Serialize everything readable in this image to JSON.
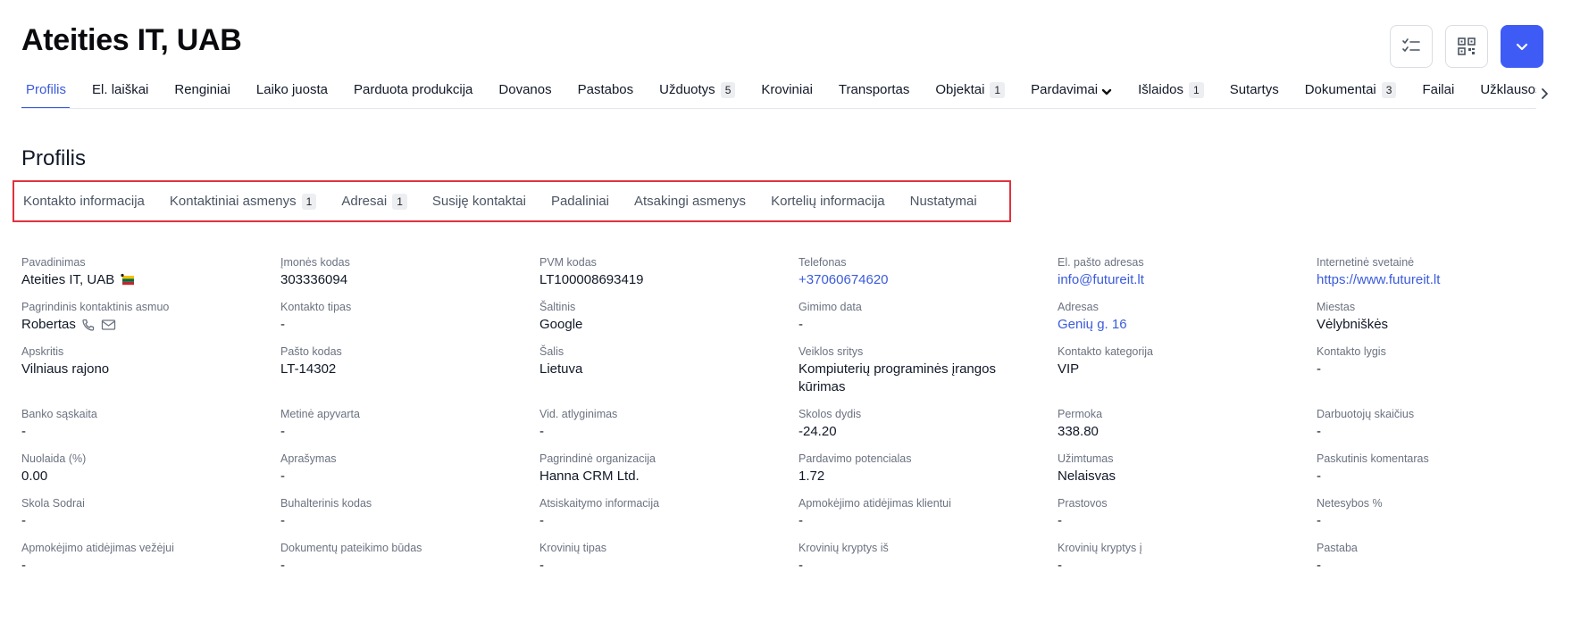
{
  "header": {
    "title": "Ateities IT, UAB"
  },
  "main_tabs": [
    {
      "label": "Profilis",
      "active": true
    },
    {
      "label": "El. laiškai"
    },
    {
      "label": "Renginiai"
    },
    {
      "label": "Laiko juosta"
    },
    {
      "label": "Parduota produkcija"
    },
    {
      "label": "Dovanos"
    },
    {
      "label": "Pastabos"
    },
    {
      "label": "Užduotys",
      "badge": "5"
    },
    {
      "label": "Kroviniai"
    },
    {
      "label": "Transportas"
    },
    {
      "label": "Objektai",
      "badge": "1"
    },
    {
      "label": "Pardavimai",
      "dropdown": true
    },
    {
      "label": "Išlaidos",
      "badge": "1"
    },
    {
      "label": "Sutartys"
    },
    {
      "label": "Dokumentai",
      "badge": "3"
    },
    {
      "label": "Failai"
    },
    {
      "label": "Užklausos"
    }
  ],
  "section": {
    "title": "Profilis"
  },
  "sub_tabs": [
    {
      "label": "Kontakto informacija"
    },
    {
      "label": "Kontaktiniai asmenys",
      "badge": "1"
    },
    {
      "label": "Adresai",
      "badge": "1"
    },
    {
      "label": "Susiję kontaktai"
    },
    {
      "label": "Padaliniai"
    },
    {
      "label": "Atsakingi asmenys"
    },
    {
      "label": "Kortelių informacija"
    },
    {
      "label": "Nustatymai"
    }
  ],
  "fields": {
    "row1": {
      "name_label": "Pavadinimas",
      "name_value": "Ateities IT, UAB",
      "company_code_label": "Įmonės kodas",
      "company_code_value": "303336094",
      "vat_label": "PVM kodas",
      "vat_value": "LT100008693419",
      "phone_label": "Telefonas",
      "phone_value": "+37060674620",
      "email_label": "El. pašto adresas",
      "email_value": "info@futureit.lt",
      "website_label": "Internetinė svetainė",
      "website_value": "https://www.futureit.lt"
    },
    "row2": {
      "main_contact_label": "Pagrindinis kontaktinis asmuo",
      "main_contact_value": "Robertas",
      "contact_type_label": "Kontakto tipas",
      "contact_type_value": "-",
      "source_label": "Šaltinis",
      "source_value": "Google",
      "birth_label": "Gimimo data",
      "birth_value": "-",
      "address_label": "Adresas",
      "address_value": "Genių g. 16",
      "city_label": "Miestas",
      "city_value": "Vėlybniškės"
    },
    "row3": {
      "county_label": "Apskritis",
      "county_value": "Vilniaus rajono",
      "postal_label": "Pašto kodas",
      "postal_value": "LT-14302",
      "country_label": "Šalis",
      "country_value": "Lietuva",
      "activity_label": "Veiklos sritys",
      "activity_value": "Kompiuterių programinės įrangos kūrimas",
      "category_label": "Kontakto kategorija",
      "category_value": "VIP",
      "level_label": "Kontakto lygis",
      "level_value": "-"
    },
    "row4": {
      "bank_label": "Banko sąskaita",
      "bank_value": "-",
      "turnover_label": "Metinė apyvarta",
      "turnover_value": "-",
      "salary_label": "Vid. atlyginimas",
      "salary_value": "-",
      "debt_label": "Skolos dydis",
      "debt_value": "-24.20",
      "overpay_label": "Permoka",
      "overpay_value": "338.80",
      "employees_label": "Darbuotojų skaičius",
      "employees_value": "-"
    },
    "row5": {
      "discount_label": "Nuolaida (%)",
      "discount_value": "0.00",
      "description_label": "Aprašymas",
      "description_value": "-",
      "org_label": "Pagrindinė organizacija",
      "org_value": "Hanna CRM Ltd.",
      "potential_label": "Pardavimo potencialas",
      "potential_value": "1.72",
      "busy_label": "Užimtumas",
      "busy_value": "Nelaisvas",
      "last_comment_label": "Paskutinis komentaras",
      "last_comment_value": "-"
    },
    "row6": {
      "sodra_label": "Skola Sodrai",
      "sodra_value": "-",
      "accounting_label": "Buhalterinis kodas",
      "accounting_value": "-",
      "settlement_label": "Atsiskaitymo informacija",
      "settlement_value": "-",
      "payment_delay_label": "Apmokėjimo atidėjimas klientui",
      "payment_delay_value": "-",
      "downtime_label": "Prastovos",
      "downtime_value": "-",
      "loss_label": "Netesybos %",
      "loss_value": "-"
    },
    "row7": {
      "carrier_delay_label": "Apmokėjimo atidėjimas vežėjui",
      "carrier_delay_value": "-",
      "doc_method_label": "Dokumentų pateikimo būdas",
      "doc_method_value": "-",
      "cargo_type_label": "Krovinių tipas",
      "cargo_type_value": "-",
      "cargo_from_label": "Krovinių kryptys iš",
      "cargo_from_value": "-",
      "cargo_to_label": "Krovinių kryptys į",
      "cargo_to_value": "-",
      "note_label": "Pastaba",
      "note_value": "-"
    }
  },
  "icons": {
    "flag": "lithuania-flag-icon",
    "phone": "phone-icon",
    "mail": "mail-icon",
    "checklist": "checklist-icon",
    "qr": "qr-code-icon",
    "chevron": "chevron-down-icon"
  },
  "colors": {
    "accent": "#3b5bdb",
    "primary_button": "#3f5bf6",
    "highlight_border": "#e0323d"
  }
}
